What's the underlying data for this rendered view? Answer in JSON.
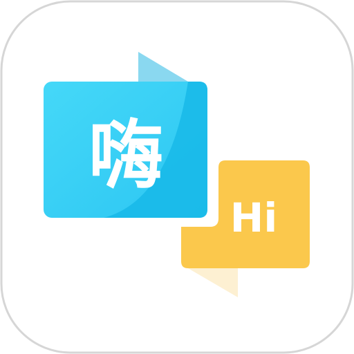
{
  "app_icon": {
    "chinese_text": "嗨",
    "english_text": "Hi",
    "icon_name": "translation-chat-icon"
  },
  "colors": {
    "background": "#ffffff",
    "border": "#d6d6d6",
    "blue_bubble": "#3fd3f6",
    "blue_dark": "#18b8e8",
    "blue_fold": "#8ad8f0",
    "yellow_bubble": "#fbc84c",
    "yellow_fold": "#fdf0d2",
    "text_white": "#ffffff"
  }
}
